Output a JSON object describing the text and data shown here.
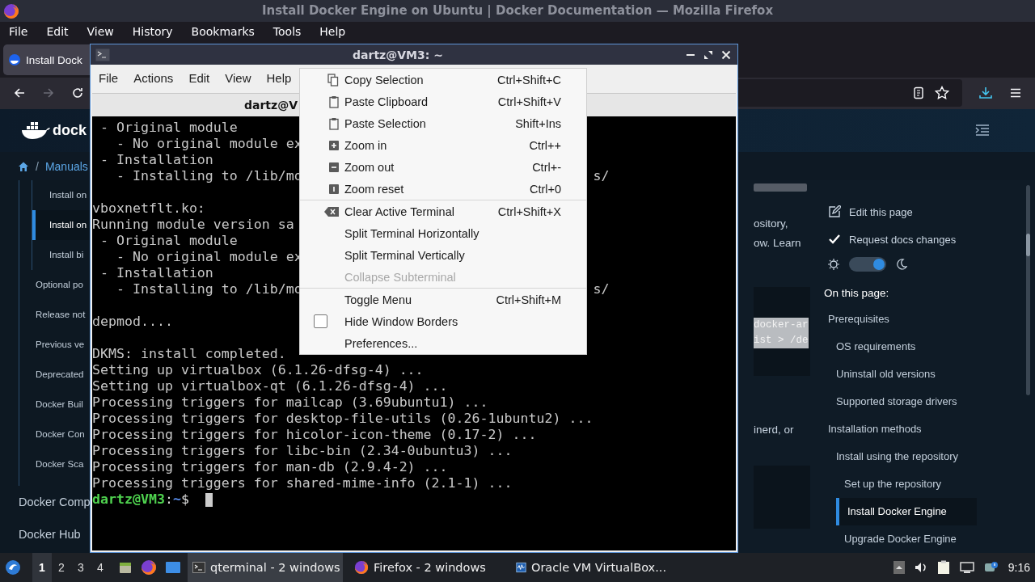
{
  "firefox": {
    "title": "Install Docker Engine on Ubuntu | Docker Documentation — Mozilla Firefox",
    "menu": [
      "File",
      "Edit",
      "View",
      "History",
      "Bookmarks",
      "Tools",
      "Help"
    ],
    "tab": {
      "label": "Install Dock"
    },
    "page": {
      "logo": "dock",
      "breadcrumb_separator": "/",
      "breadcrumb": [
        "Manuals"
      ],
      "nav": [
        {
          "children": [
            {
              "children": [
                {
                  "label": "Install on",
                  "selected": false
                },
                {
                  "label": "Install on",
                  "selected": true
                },
                {
                  "label": "Install bi",
                  "selected": false
                }
              ]
            },
            {
              "label": "Optional po",
              "selected": false
            },
            {
              "label": "Release not",
              "selected": false
            },
            {
              "label": "Previous ve",
              "selected": false
            },
            {
              "label": "Deprecated",
              "selected": false
            },
            {
              "label": "Docker Buil",
              "selected": false
            },
            {
              "label": "Docker Con",
              "selected": false
            },
            {
              "label": "Docker Sca",
              "selected": false
            }
          ]
        },
        {
          "label": "Docker Comp",
          "selected": false
        },
        {
          "label": "Docker Hub",
          "selected": false
        }
      ],
      "content": {
        "lines_a": [
          "ository,",
          "ow. Learn"
        ],
        "code": [
          "docker-ar",
          "ist > /de"
        ],
        "lines_b": [
          "inerd, or"
        ]
      },
      "actions": [
        "Edit this page",
        "Request docs changes"
      ],
      "theme_toggle": {
        "on": true
      },
      "toc_heading": "On this page:",
      "toc": [
        {
          "label": "Prerequisites",
          "selected": false,
          "children": [
            {
              "label": "OS requirements",
              "selected": false
            },
            {
              "label": "Uninstall old versions",
              "selected": false
            },
            {
              "label": "Supported storage drivers",
              "selected": false
            }
          ]
        },
        {
          "label": "Installation methods",
          "selected": false,
          "children": [
            {
              "label": "Install using the repository",
              "selected": false,
              "children": [
                {
                  "label": "Set up the repository",
                  "selected": false
                },
                {
                  "label": "Install Docker Engine",
                  "selected": true
                },
                {
                  "label": "Upgrade Docker Engine",
                  "selected": false
                }
              ]
            }
          ]
        }
      ]
    }
  },
  "terminal": {
    "title": "dartz@VM3: ~",
    "menu": [
      "File",
      "Actions",
      "Edit",
      "View",
      "Help"
    ],
    "tab": "dartz@V",
    "lines": [
      {
        "kind": "output",
        "text": " - Original module"
      },
      {
        "kind": "output",
        "text": "   - No original module ex"
      },
      {
        "kind": "output",
        "text": " - Installation"
      },
      {
        "kind": "output",
        "text": "   - Installing to /lib/mo",
        "tail": "s/"
      },
      {
        "kind": "blank"
      },
      {
        "kind": "output",
        "text": "vboxnetflt.ko:"
      },
      {
        "kind": "output",
        "text": "Running module version sa"
      },
      {
        "kind": "output",
        "text": " - Original module"
      },
      {
        "kind": "output",
        "text": "   - No original module ex"
      },
      {
        "kind": "output",
        "text": " - Installation"
      },
      {
        "kind": "output",
        "text": "   - Installing to /lib/mo",
        "tail": "s/"
      },
      {
        "kind": "blank"
      },
      {
        "kind": "output",
        "text": "depmod...."
      },
      {
        "kind": "blank"
      },
      {
        "kind": "output",
        "text": "DKMS: install completed."
      },
      {
        "kind": "output",
        "text": "Setting up virtualbox (6.1.26-dfsg-4) ..."
      },
      {
        "kind": "output",
        "text": "Setting up virtualbox-qt (6.1.26-dfsg-4) ..."
      },
      {
        "kind": "output",
        "text": "Processing triggers for mailcap (3.69ubuntu1) ..."
      },
      {
        "kind": "output",
        "text": "Processing triggers for desktop-file-utils (0.26-1ubuntu2) ..."
      },
      {
        "kind": "output",
        "text": "Processing triggers for hicolor-icon-theme (0.17-2) ..."
      },
      {
        "kind": "output",
        "text": "Processing triggers for libc-bin (2.34-0ubuntu3) ..."
      },
      {
        "kind": "output",
        "text": "Processing triggers for man-db (2.9.4-2) ..."
      },
      {
        "kind": "output",
        "text": "Processing triggers for shared-mime-info (2.1-1) ..."
      },
      {
        "kind": "prompt",
        "user": "dartz@VM3",
        "separator": ":",
        "path": "~",
        "symbol": "$"
      }
    ]
  },
  "context_menu": [
    {
      "kind": "action",
      "label": "Copy Selection",
      "shortcut": "Ctrl+Shift+C",
      "disabled": false
    },
    {
      "kind": "action",
      "label": "Paste Clipboard",
      "shortcut": "Ctrl+Shift+V",
      "disabled": false
    },
    {
      "kind": "action",
      "label": "Paste Selection",
      "shortcut": "Shift+Ins",
      "disabled": false
    },
    {
      "kind": "action",
      "label": "Zoom in",
      "shortcut": "Ctrl++",
      "disabled": false
    },
    {
      "kind": "action",
      "label": "Zoom out",
      "shortcut": "Ctrl+-",
      "disabled": false
    },
    {
      "kind": "action",
      "label": "Zoom reset",
      "shortcut": "Ctrl+0",
      "disabled": false
    },
    {
      "kind": "separator"
    },
    {
      "kind": "action",
      "label": "Clear Active Terminal",
      "shortcut": "Ctrl+Shift+X",
      "disabled": false
    },
    {
      "kind": "action",
      "label": "Split Terminal Horizontally",
      "disabled": false
    },
    {
      "kind": "action",
      "label": "Split Terminal Vertically",
      "disabled": false
    },
    {
      "kind": "action",
      "label": "Collapse Subterminal",
      "disabled": true
    },
    {
      "kind": "separator"
    },
    {
      "kind": "action",
      "label": "Toggle Menu",
      "shortcut": "Ctrl+Shift+M",
      "disabled": false
    },
    {
      "kind": "checkbox",
      "label": "Hide Window Borders",
      "checked": false
    },
    {
      "kind": "action",
      "label": "Preferences...",
      "disabled": false
    }
  ],
  "taskbar": {
    "workspaces": [
      {
        "label": "1",
        "selected": true
      },
      {
        "label": "2",
        "selected": false
      },
      {
        "label": "3",
        "selected": false
      },
      {
        "label": "4",
        "selected": false
      }
    ],
    "tasks": [
      {
        "label": "qterminal - 2 windows",
        "selected": true
      },
      {
        "label": "Firefox - 2 windows",
        "selected": false
      },
      {
        "label": "Oracle VM VirtualBox...",
        "selected": false
      }
    ],
    "clock": "9:16"
  }
}
